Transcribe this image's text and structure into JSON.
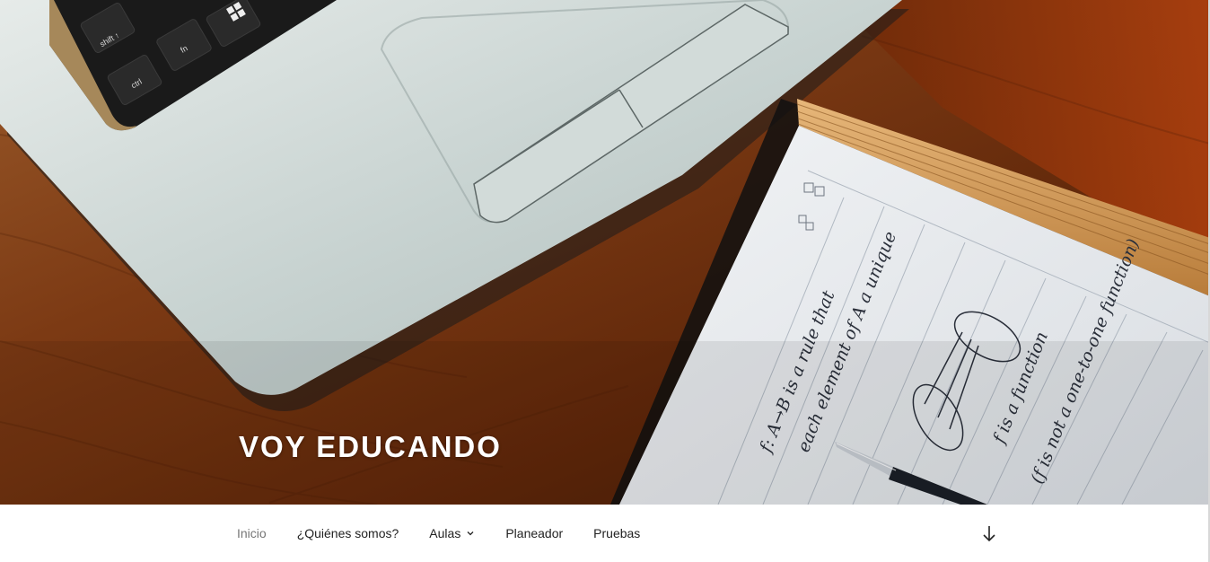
{
  "site": {
    "title": "VOY EDUCANDO"
  },
  "nav": {
    "items": [
      {
        "label": "Inicio",
        "current": true,
        "has_submenu": false
      },
      {
        "label": "¿Quiénes somos?",
        "current": false,
        "has_submenu": false
      },
      {
        "label": "Aulas",
        "current": false,
        "has_submenu": true
      },
      {
        "label": "Planeador",
        "current": false,
        "has_submenu": false
      },
      {
        "label": "Pruebas",
        "current": false,
        "has_submenu": false
      }
    ],
    "submenu_icon": "chevron-down-icon",
    "scroll_icon": "arrow-down-icon"
  },
  "header_image": {
    "keyboard_keys": [
      "shift ↑",
      "fn",
      "ctrl"
    ],
    "notebook_lines": [
      "f: A→B is a rule that",
      "each element of A a unique",
      "f is a function",
      "(f is not a one-to-one function)"
    ]
  },
  "colors": {
    "nav_text": "#222222",
    "nav_current": "#767676",
    "title": "#ffffff",
    "wood": "#7a3a12",
    "laptop": "#c9d2d0",
    "paper": "#e9ecef"
  }
}
